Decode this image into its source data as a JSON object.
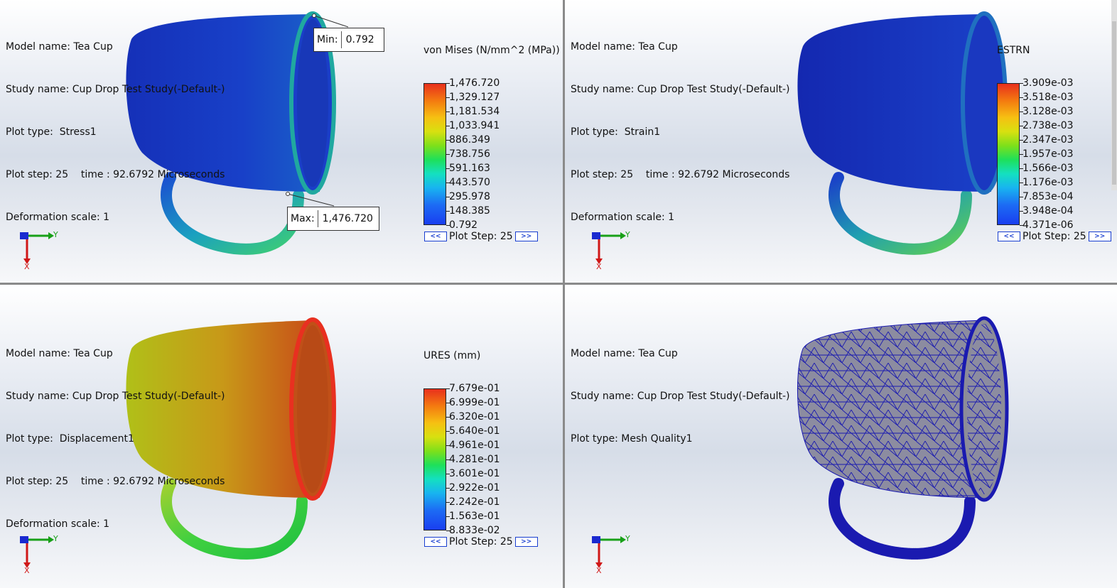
{
  "viewports": [
    {
      "info": [
        "Model name: Tea Cup",
        "Study name: Cup Drop Test Study(-Default-)",
        "Plot type:  Stress1",
        "Plot step: 25    time : 92.6792 Microseconds",
        "Deformation scale: 1"
      ],
      "legend_title": "von Mises (N/mm^2 (MPa))",
      "ticks": [
        "1,476.720",
        "1,329.127",
        "1,181.534",
        "1,033.941",
        "886.349",
        "738.756",
        "591.163",
        "443.570",
        "295.978",
        "148.385",
        "0.792"
      ],
      "plot_step": "Plot Step: 25",
      "min_label": "Min:",
      "min_value": "0.792",
      "max_label": "Max:",
      "max_value": "1,476.720"
    },
    {
      "info": [
        "Model name: Tea Cup",
        "Study name: Cup Drop Test Study(-Default-)",
        "Plot type:  Strain1",
        "Plot step: 25    time : 92.6792 Microseconds",
        "Deformation scale: 1"
      ],
      "legend_title": "ESTRN",
      "ticks": [
        "3.909e-03",
        "3.518e-03",
        "3.128e-03",
        "2.738e-03",
        "2.347e-03",
        "1.957e-03",
        "1.566e-03",
        "1.176e-03",
        "7.853e-04",
        "3.948e-04",
        "4.371e-06"
      ],
      "plot_step": "Plot Step: 25"
    },
    {
      "info": [
        "Model name: Tea Cup",
        "Study name: Cup Drop Test Study(-Default-)",
        "Plot type:  Displacement1",
        "Plot step: 25    time : 92.6792 Microseconds",
        "Deformation scale: 1"
      ],
      "legend_title": "URES (mm)",
      "ticks": [
        "7.679e-01",
        "6.999e-01",
        "6.320e-01",
        "5.640e-01",
        "4.961e-01",
        "4.281e-01",
        "3.601e-01",
        "2.922e-01",
        "2.242e-01",
        "1.563e-01",
        "8.833e-02"
      ],
      "plot_step": "Plot Step: 25"
    },
    {
      "info": [
        "Model name: Tea Cup",
        "Study name: Cup Drop Test Study(-Default-)",
        "Plot type: Mesh Quality1"
      ]
    }
  ],
  "nav": {
    "prev": "<<",
    "next": ">>"
  },
  "triad": {
    "x": "X",
    "y": "Y",
    "z": "Z"
  },
  "colors": {
    "triad_x": "#d01818",
    "triad_y": "#18a018",
    "triad_z": "#1a2ad0",
    "mesh_line": "#1a1ab0"
  }
}
